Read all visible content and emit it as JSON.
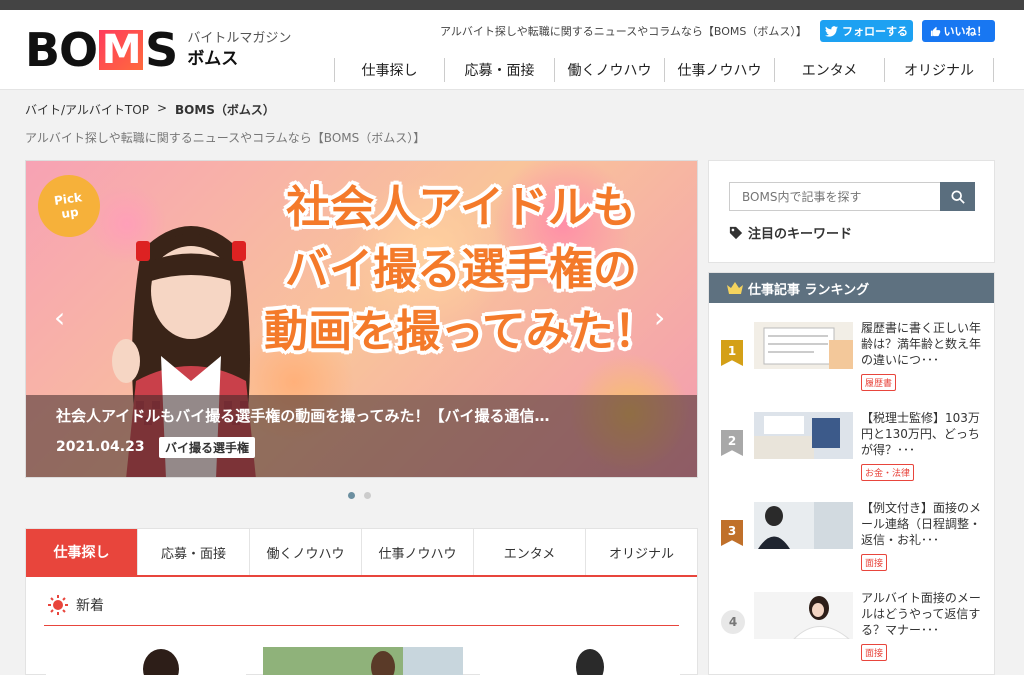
{
  "header": {
    "logo": {
      "word": "BOMS",
      "sub_line1": "バイトルマガジン",
      "sub_line2": "ボムス"
    },
    "tagline": "アルバイト探しや転職に関するニュースやコラムなら【BOMS（ボムス）】",
    "follow_label": "フォローする",
    "like_label": "いいね！",
    "nav": [
      "仕事探し",
      "応募・面接",
      "働くノウハウ",
      "仕事ノウハウ",
      "エンタメ",
      "オリジナル"
    ]
  },
  "breadcrumb": {
    "home": "バイト/アルバイトTOP",
    "separator": ">",
    "current": "BOMS（ボムス）"
  },
  "subtitle": "アルバイト探しや転職に関するニュースやコラムなら【BOMS（ボムス）】",
  "hero": {
    "badge_line1": "Pick",
    "badge_line2": "up",
    "title_line1": "社会人アイドルも",
    "title_line2": "バイ撮る選手権の",
    "title_line3": "動画を撮ってみた！",
    "caption_title": "社会人アイドルもバイ撮る選手権の動画を撮ってみた！【バイ撮る通信…",
    "date": "2021.04.23",
    "tag": "バイ撮る選手権",
    "slide_count": 2,
    "active_slide": 1
  },
  "category_tabs": [
    "仕事探し",
    "応募・面接",
    "働くノウハウ",
    "仕事ノウハウ",
    "エンタメ",
    "オリジナル"
  ],
  "new_section": {
    "label": "新着"
  },
  "search": {
    "placeholder": "BOMS内で記事を探す"
  },
  "keyword_heading": "注目のキーワード",
  "ranking": {
    "heading": "仕事記事 ランキング",
    "items": [
      {
        "rank": "1",
        "title": "履歴書に書く正しい年齢は？満年齢と数え年の違いにつ･･･",
        "tag": "履歴書"
      },
      {
        "rank": "2",
        "title": "【税理士監修】103万円と130万円、どっちが得？･･･",
        "tag": "お金・法律"
      },
      {
        "rank": "3",
        "title": "【例文付き】面接のメール連絡（日程調整・返信・お礼･･･",
        "tag": "面接"
      },
      {
        "rank": "4",
        "title": "アルバイト面接のメールはどうやって返信する？マナー･･･",
        "tag": "面接"
      }
    ]
  },
  "colors": {
    "accent_red": "#e8453c",
    "twitter": "#1da1f2",
    "facebook": "#1877f2",
    "ranking_header": "#5e7180",
    "rank_gold": "#d4a017",
    "rank_silver": "#a8a8a8",
    "rank_bronze": "#c0702a"
  }
}
